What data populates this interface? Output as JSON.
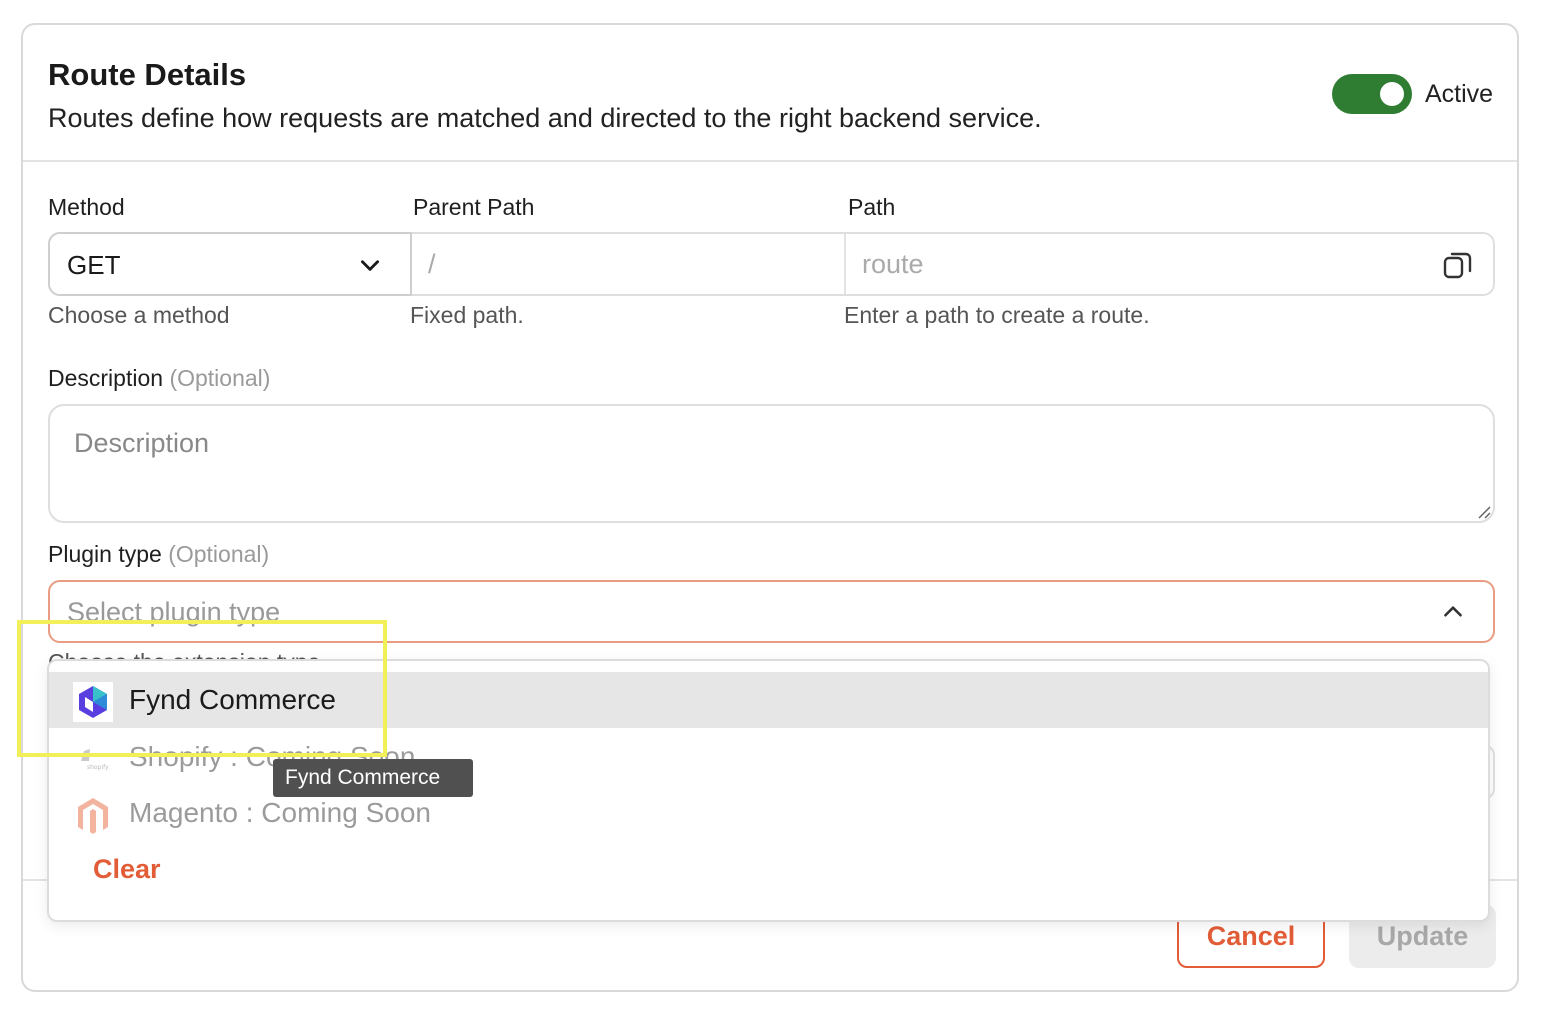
{
  "header": {
    "title": "Route Details",
    "subtitle": "Routes define how requests are matched and directed to the right backend service.",
    "status_label": "Active",
    "status_on": true
  },
  "fields": {
    "method": {
      "label": "Method",
      "value": "GET",
      "helper": "Choose a method"
    },
    "parent_path": {
      "label": "Parent Path",
      "value": "/",
      "helper": "Fixed path."
    },
    "path": {
      "label": "Path",
      "placeholder": "route",
      "helper": "Enter a path to create a route."
    },
    "description": {
      "label": "Description",
      "optional": "(Optional)",
      "placeholder": "Description"
    },
    "plugin_type": {
      "label": "Plugin type",
      "optional": "(Optional)",
      "placeholder": "Select plugin type",
      "helper": "Choose the extension type"
    }
  },
  "dropdown": {
    "options": [
      {
        "label": "Fynd Commerce",
        "icon": "fynd-commerce-icon",
        "selected": true,
        "disabled": false
      },
      {
        "label": "Shopify : Coming Soon",
        "icon": "shopify-icon",
        "selected": false,
        "disabled": true
      },
      {
        "label": "Magento : Coming Soon",
        "icon": "magento-icon",
        "selected": false,
        "disabled": true
      }
    ],
    "clear_label": "Clear",
    "tooltip": "Fynd Commerce"
  },
  "footer": {
    "cancel_label": "Cancel",
    "update_label": "Update"
  },
  "colors": {
    "accent": "#e25d37",
    "toggle_on": "#2f7d32",
    "focus_border": "#ea9c82",
    "highlight": "#f2f058"
  }
}
